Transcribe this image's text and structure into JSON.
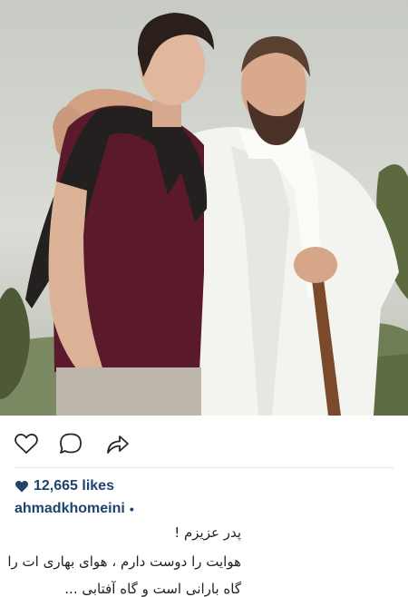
{
  "post": {
    "photo_description_icon": "photo-icon",
    "likes_count": "12,665 likes",
    "username": "ahmadkhomeini",
    "username_suffix": "•",
    "caption_lines": [
      "پدر عزیزم !",
      "هوایت را دوست دارم ، هوای بهاری ات را",
      "گاه بارانی است و گاه آفتابی ..."
    ]
  },
  "icons": {
    "like": "heart-outline-icon",
    "comment": "speech-bubble-icon",
    "share": "share-arrow-icon",
    "likes_heart": "heart-filled-icon"
  },
  "colors": {
    "username": "#20436d",
    "divider": "#e6e6e6",
    "icon_stroke": "#262626"
  }
}
